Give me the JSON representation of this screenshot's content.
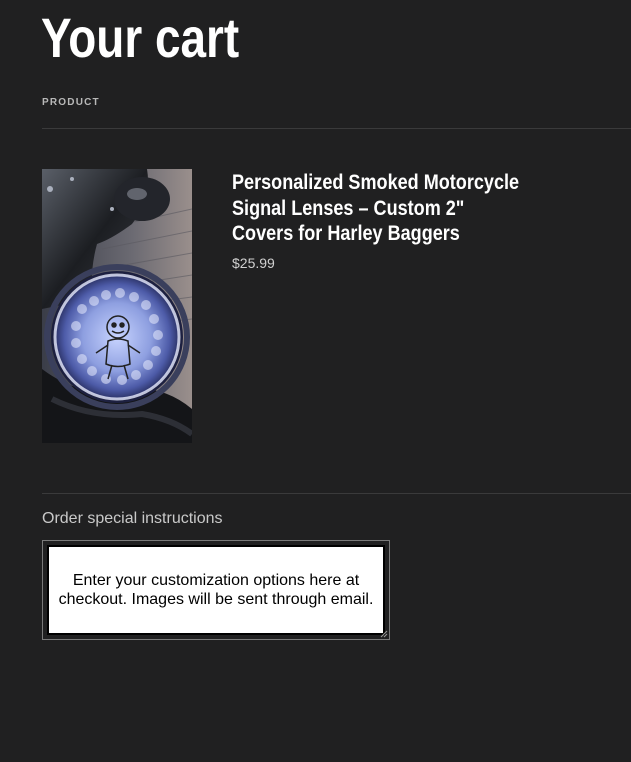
{
  "cart": {
    "title": "Your cart",
    "column_header": "PRODUCT"
  },
  "item": {
    "name": "Personalized Smoked Motorcycle Signal Lenses – Custom 2\" Covers for Harley Baggers",
    "price": "$25.99",
    "image_alt": "Smoked motorcycle signal lens with voodoo doll design"
  },
  "instructions": {
    "label": "Order special instructions",
    "text": "Enter your customization options here at checkout. Images will be sent through email."
  },
  "colors": {
    "background": "#202021",
    "text": "#ffffff",
    "muted": "#b8b8b8",
    "divider": "#3a3a3b"
  }
}
